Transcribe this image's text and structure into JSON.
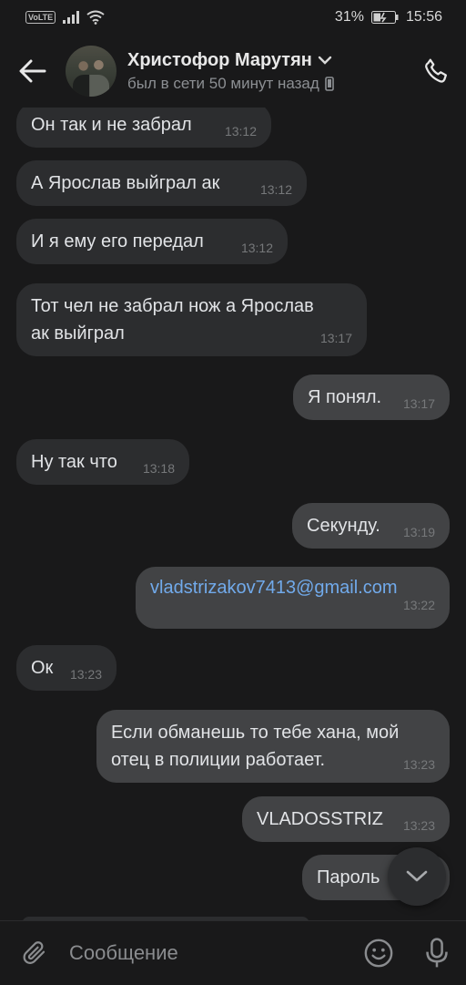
{
  "status_bar": {
    "volte": "VoLTE",
    "battery": "31%",
    "time": "15:56"
  },
  "header": {
    "name": "Христофор Марутян",
    "status": "был в сети 50 минут назад"
  },
  "messages": [
    {
      "text": "Он так и не забрал",
      "time": "13:12"
    },
    {
      "text": "А Ярослав выйграл ак",
      "time": "13:12"
    },
    {
      "text": "И я ему его передал",
      "time": "13:12"
    },
    {
      "line1": "Тот чел не забрал нож а Ярослав",
      "line2": "ак выйграл",
      "time": "13:17"
    },
    {
      "text": "Я понял.",
      "time": "13:17"
    },
    {
      "text": "Ну так что",
      "time": "13:18"
    },
    {
      "text": "Секунду.",
      "time": "13:19"
    },
    {
      "text": "vladstrizakov7413@gmail.com",
      "time": "13:22"
    },
    {
      "text": "Ок",
      "time": "13:23"
    },
    {
      "line1": "Если обманешь то тебе хана, мой",
      "line2": "отец в полиции работает.",
      "time": "13:23"
    },
    {
      "text": "VLADOSSTRIZ",
      "time": "13:23"
    },
    {
      "text": "Пароль"
    }
  ],
  "composer": {
    "placeholder": "Сообщение"
  },
  "icons": {
    "back": "arrow-left-icon",
    "chevron": "chevron-down-icon",
    "phone": "phone-icon",
    "device": "smartphone-icon",
    "attach": "paperclip-icon",
    "emoji": "smile-icon",
    "mic": "microphone-icon",
    "scroll": "chevron-down-icon"
  },
  "colors": {
    "background": "#19191a",
    "incoming": "#2c2d2f",
    "outgoing": "#424345",
    "link": "#71aaeb"
  }
}
